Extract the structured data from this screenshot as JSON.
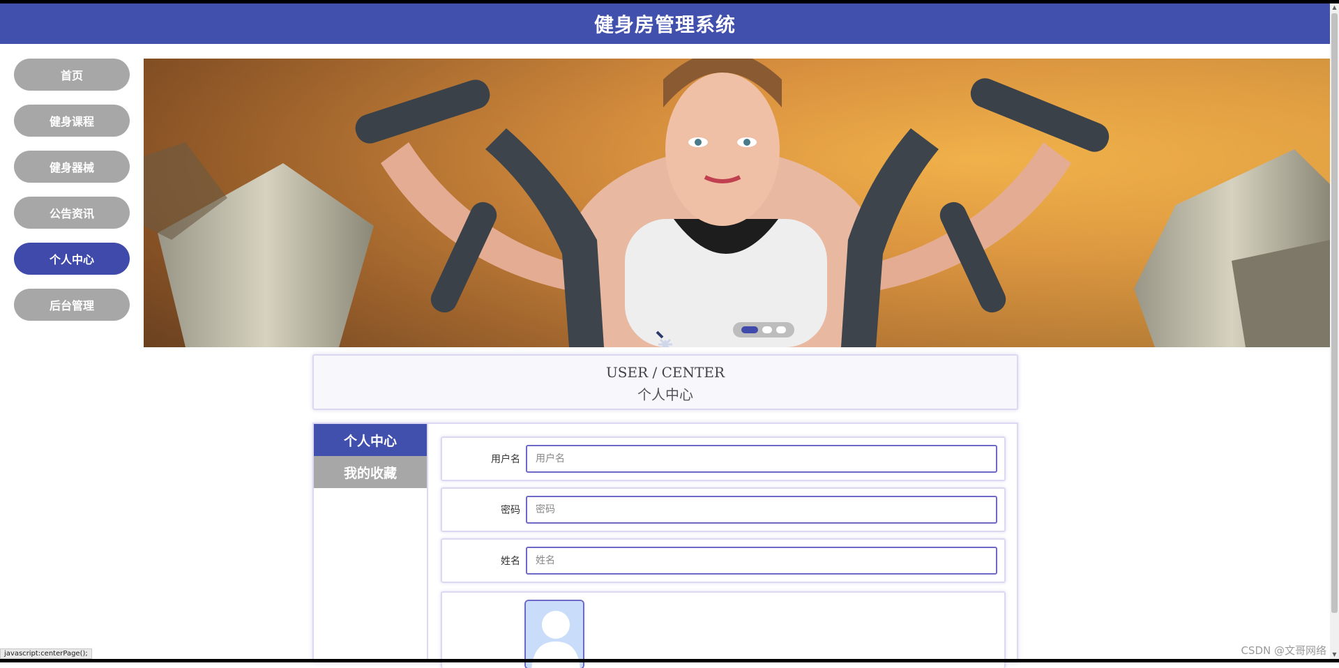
{
  "header": {
    "title": "健身房管理系统"
  },
  "nav": {
    "items": [
      {
        "label": "首页",
        "active": false
      },
      {
        "label": "健身课程",
        "active": false
      },
      {
        "label": "健身器械",
        "active": false
      },
      {
        "label": "公告资讯",
        "active": false
      },
      {
        "label": "个人中心",
        "active": true
      },
      {
        "label": "后台管理",
        "active": false
      }
    ]
  },
  "banner": {
    "slides": 3,
    "active_slide": 1
  },
  "page_title": {
    "en": "USER / CENTER",
    "cn": "个人中心"
  },
  "side_tabs": [
    {
      "label": "个人中心",
      "active": true
    },
    {
      "label": "我的收藏",
      "active": false
    }
  ],
  "form": {
    "username": {
      "label": "用户名",
      "placeholder": "用户名",
      "value": ""
    },
    "password": {
      "label": "密码",
      "placeholder": "密码",
      "value": ""
    },
    "name": {
      "label": "姓名",
      "placeholder": "姓名",
      "value": ""
    }
  },
  "status_bar": {
    "text": "javascript:centerPage();"
  },
  "watermark": {
    "text": "CSDN @文哥网络"
  },
  "colors": {
    "primary": "#4150ac",
    "nav_inactive": "#a7a7a7",
    "border": "#dcd8f2"
  }
}
